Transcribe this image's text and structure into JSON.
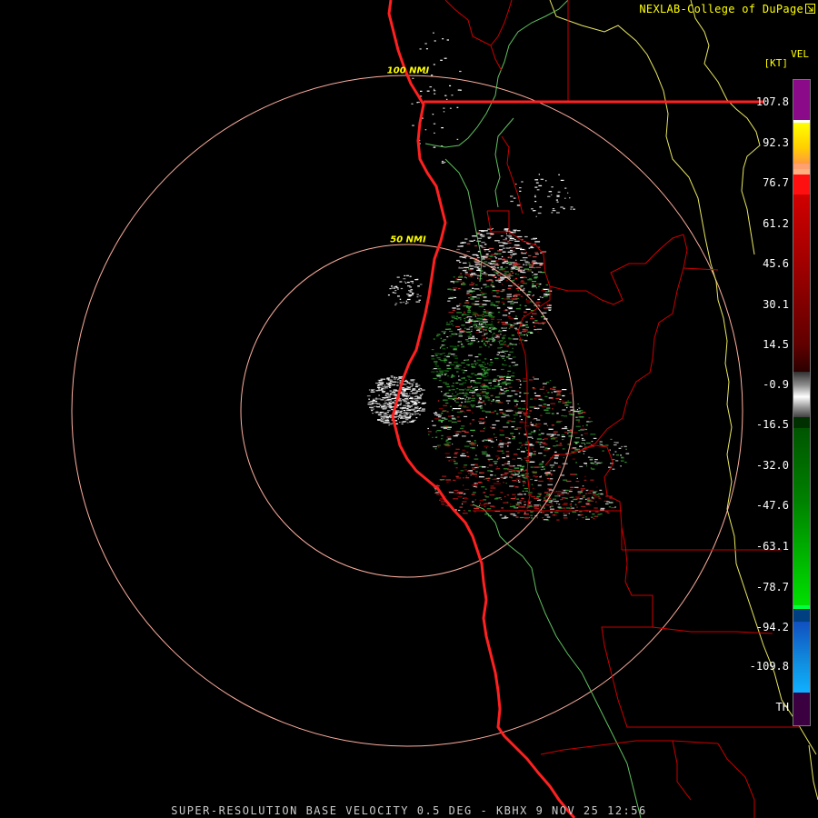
{
  "header": {
    "credit": "NEXLAB-College of DuPage"
  },
  "footer": {
    "title": "SUPER-RESOLUTION BASE VELOCITY 0.5 DEG - KBHX 9 NOV 25 12:56"
  },
  "range_rings": {
    "inner_label": "50 NMI",
    "outer_label": "100 NMI"
  },
  "legend": {
    "product": "VEL",
    "units": "[KT]",
    "ticks": [
      "107.8",
      "92.3",
      "76.7",
      "61.2",
      "45.6",
      "30.1",
      "14.5",
      "-0.9",
      "-16.5",
      "-32.0",
      "-47.6",
      "-63.1",
      "-78.7",
      "-94.2",
      "-109.8",
      "TH"
    ]
  },
  "colors": {
    "range_ring": "#ffb0a0",
    "coastline": "#ff2020",
    "state_border": "#ff2020",
    "county_border": "#cc0000",
    "boundary_yellow": "#e8e860",
    "boundary_green": "#60c060",
    "label": "#ffff00"
  }
}
